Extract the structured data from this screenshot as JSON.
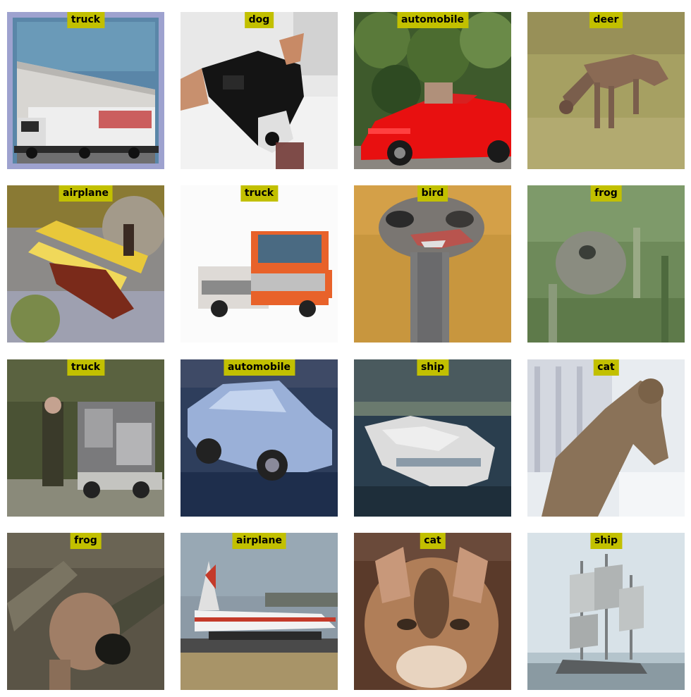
{
  "tiles": [
    {
      "label": "truck",
      "scene": "truck-warehouse"
    },
    {
      "label": "dog",
      "scene": "dog-black-white"
    },
    {
      "label": "automobile",
      "scene": "red-convertible"
    },
    {
      "label": "deer",
      "scene": "deer-grass"
    },
    {
      "label": "airplane",
      "scene": "yellow-biplane"
    },
    {
      "label": "truck",
      "scene": "orange-truck"
    },
    {
      "label": "bird",
      "scene": "ostrich"
    },
    {
      "label": "frog",
      "scene": "frog-grass"
    },
    {
      "label": "truck",
      "scene": "truck-trees"
    },
    {
      "label": "automobile",
      "scene": "blue-sedan"
    },
    {
      "label": "ship",
      "scene": "white-boat"
    },
    {
      "label": "cat",
      "scene": "cat-snow"
    },
    {
      "label": "frog",
      "scene": "frog-mud"
    },
    {
      "label": "airplane",
      "scene": "jet-runway"
    },
    {
      "label": "cat",
      "scene": "cat-face"
    },
    {
      "label": "ship",
      "scene": "sailing-ship"
    }
  ]
}
